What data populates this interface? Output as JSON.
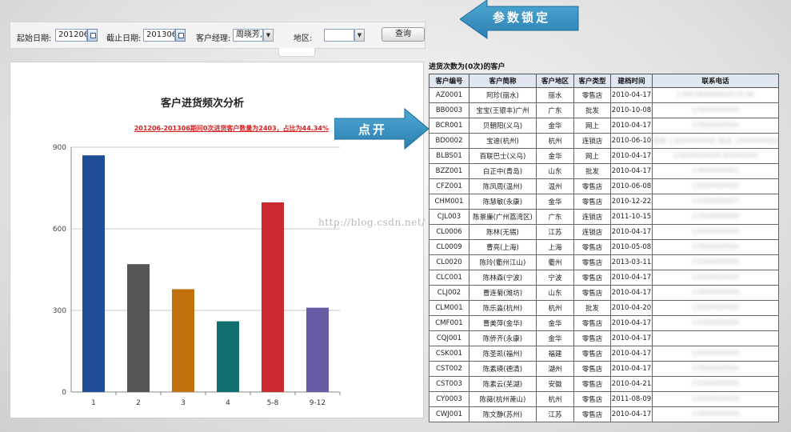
{
  "filter": {
    "start_label": "起始日期:",
    "start_value": "201206",
    "end_label": "截止日期:",
    "end_value": "201306",
    "manager_label": "客户经理:",
    "manager_value": "周晓芳,...",
    "region_label": "地区:",
    "region_value": "",
    "query_label": "查询"
  },
  "arrows": {
    "lock_label": "参数锁定",
    "open_label": "点开"
  },
  "watermark": "http://blog.csdn.net/",
  "chart_data": {
    "type": "bar",
    "title": "客户进货频次分析",
    "subtitle": "201206-201306期间0次进货客户数量为2403，占比为44.34%",
    "categories": [
      "1",
      "2",
      "3",
      "4",
      "5-8",
      "9-12"
    ],
    "values": [
      870,
      470,
      378,
      260,
      697,
      310
    ],
    "colors": [
      "#1f4e96",
      "#555555",
      "#c0700c",
      "#0f6e6e",
      "#c9282f",
      "#6a5ba6"
    ],
    "yticks": [
      0,
      300,
      600,
      900
    ],
    "ylim": [
      0,
      900
    ]
  },
  "table": {
    "caption": "进货次数为(0次)的客户",
    "headers": [
      "客户编号",
      "客户简称",
      "客户地区",
      "客户类型",
      "建档时间",
      "联系电话"
    ],
    "rows": [
      [
        "AZ0001",
        "阿珍(丽水)",
        "丽水",
        "零售店",
        "2010-04-17",
        "13957800006/0578 80"
      ],
      [
        "BB0003",
        "宝宝(王银丰)广州",
        "广东",
        "批发",
        "2010-10-08",
        "13600000000"
      ],
      [
        "BCR001",
        "贝朝阳(义乌)",
        "金华",
        "网上",
        "2010-04-17",
        "13500000000"
      ],
      [
        "BD0002",
        "宝迪(杭州)",
        "杭州",
        "连锁店",
        "2010-06-10",
        "周某 13000000000 电话 13000000020"
      ],
      [
        "BLBS01",
        "百联巴士(义乌)",
        "金华",
        "网上",
        "2010-04-17",
        "13500000000 85000000"
      ],
      [
        "BZZ001",
        "白正中(青岛)",
        "山东",
        "批发",
        "2010-04-17",
        "13600000001"
      ],
      [
        "CFZ001",
        "陈凤周(温州)",
        "温州",
        "零售店",
        "2010-06-08",
        "13500000000"
      ],
      [
        "CHM001",
        "陈慧敏(永康)",
        "金华",
        "零售店",
        "2010-12-22",
        "13500000007"
      ],
      [
        "CJL003",
        "陈景廉(广州荔湾区)",
        "广东",
        "连锁店",
        "2011-10-15",
        "13500000000"
      ],
      [
        "CL0006",
        "陈林(无锡)",
        "江苏",
        "连锁店",
        "2010-04-17",
        "13500000000"
      ],
      [
        "CL0009",
        "曹亮(上海)",
        "上海",
        "零售店",
        "2010-05-08",
        "13500000000"
      ],
      [
        "CL0020",
        "陈玲(衢州江山)",
        "衢州",
        "零售店",
        "2013-03-11",
        "13500000000"
      ],
      [
        "CLC001",
        "陈林森(宁波)",
        "宁波",
        "零售店",
        "2010-04-17",
        "13500000000"
      ],
      [
        "CLJ002",
        "曹连菊(潍坊)",
        "山东",
        "零售店",
        "2010-04-17",
        "13500000000"
      ],
      [
        "CLM001",
        "陈乐淼(杭州)",
        "杭州",
        "批发",
        "2010-04-20",
        "13500000000"
      ],
      [
        "CMF001",
        "曹美萍(金华)",
        "金华",
        "零售店",
        "2010-04-17",
        "13500000000"
      ],
      [
        "CQJ001",
        "陈侨齐(永康)",
        "金华",
        "零售店",
        "2010-04-17",
        ""
      ],
      [
        "CSK001",
        "陈圣凯(福州)",
        "福建",
        "零售店",
        "2010-04-17",
        "13500000000"
      ],
      [
        "CST002",
        "陈素瑛(德清)",
        "湖州",
        "零售店",
        "2010-04-17",
        "13500000000"
      ],
      [
        "CST003",
        "陈素云(芜湖)",
        "安徽",
        "零售店",
        "2010-04-21",
        "13500000000"
      ],
      [
        "CY0003",
        "陈薇(杭州萧山)",
        "杭州",
        "零售店",
        "2011-08-09",
        "13500000009"
      ],
      [
        "CWJ001",
        "陈文静(苏州)",
        "江苏",
        "零售店",
        "2010-04-17",
        "13500000000"
      ]
    ]
  }
}
